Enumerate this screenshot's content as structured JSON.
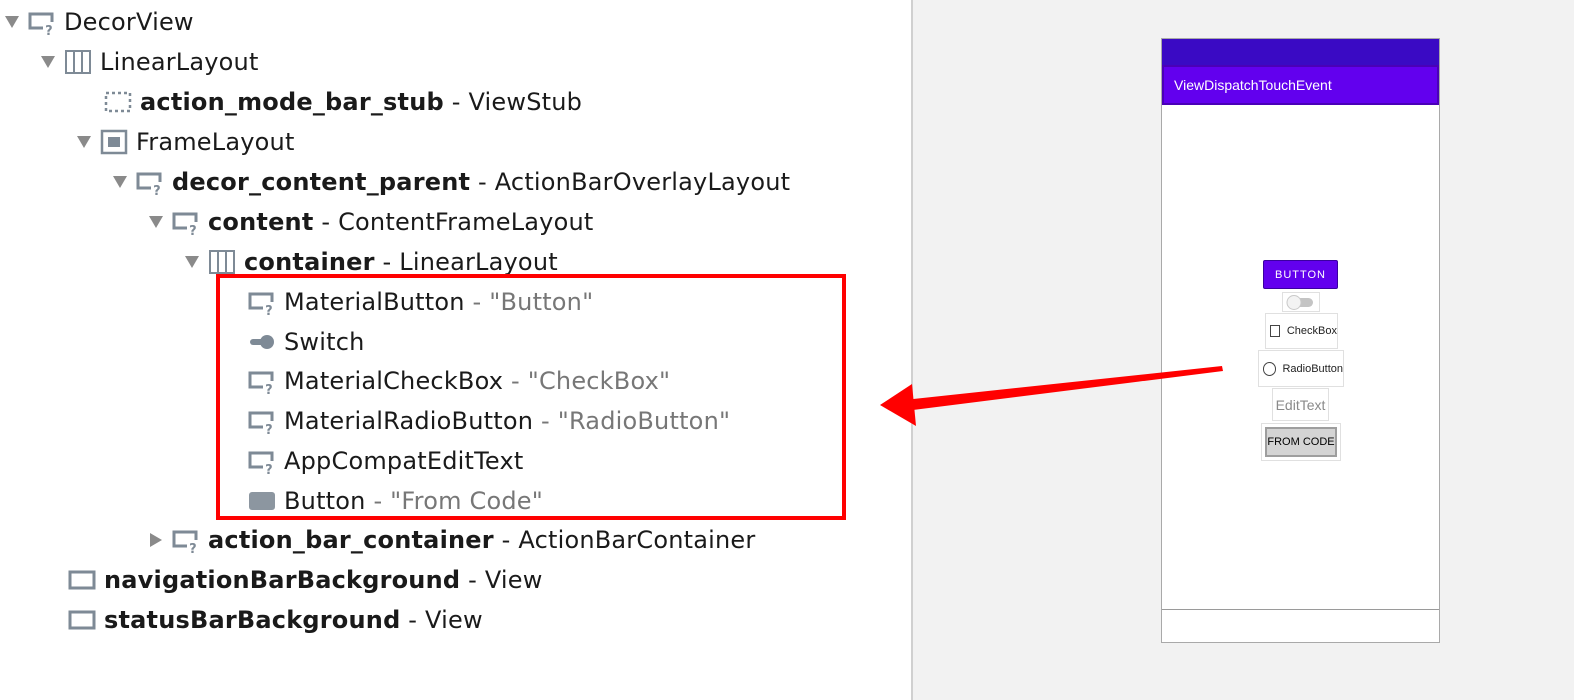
{
  "tree": {
    "rows": [
      {
        "name": "DecorView"
      },
      {
        "name": "LinearLayout"
      },
      {
        "name": "action_mode_bar_stub",
        "sep": "-",
        "type": "ViewStub"
      },
      {
        "name": "FrameLayout"
      },
      {
        "name": "decor_content_parent",
        "sep": "-",
        "type": "ActionBarOverlayLayout"
      },
      {
        "name": "content",
        "sep": "-",
        "type": "ContentFrameLayout"
      },
      {
        "name": "container",
        "sep": "-",
        "type": "LinearLayout"
      },
      {
        "name": "MaterialButton",
        "sep": "-",
        "value": "\"Button\""
      },
      {
        "name": "Switch"
      },
      {
        "name": "MaterialCheckBox",
        "sep": "-",
        "value": "\"CheckBox\""
      },
      {
        "name": "MaterialRadioButton",
        "sep": "-",
        "value": "\"RadioButton\""
      },
      {
        "name": "AppCompatEditText"
      },
      {
        "name": "Button",
        "sep": "-",
        "value": "\"From Code\""
      },
      {
        "name": "action_bar_container",
        "sep": "-",
        "type": "ActionBarContainer"
      },
      {
        "name": "navigationBarBackground",
        "sep": "-",
        "type": "View"
      },
      {
        "name": "statusBarBackground",
        "sep": "-",
        "type": "View"
      }
    ]
  },
  "preview": {
    "app_title": "ViewDispatchTouchEvent",
    "button_label": "BUTTON",
    "checkbox_label": "CheckBox",
    "radio_label": "RadioButton",
    "edittext_hint": "EditText",
    "fromcode_label": "FROM CODE",
    "accent_color": "#6200ee"
  },
  "annotation": {
    "box_color": "#ff0000",
    "arrow_color": "#ff0000"
  }
}
